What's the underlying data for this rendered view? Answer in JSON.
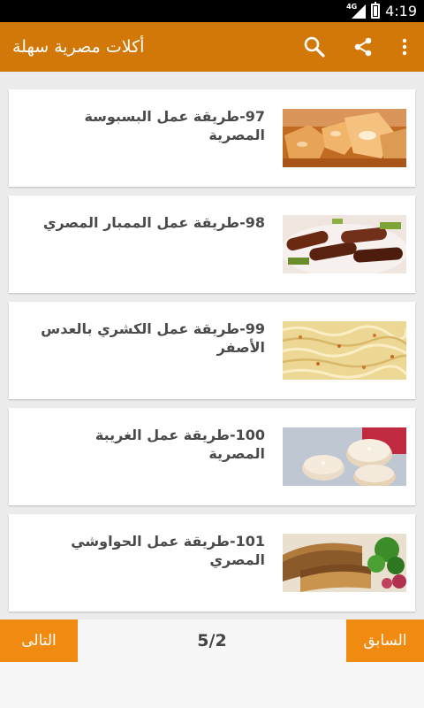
{
  "status_bar": {
    "network": "4G",
    "time": "4:19"
  },
  "app_bar": {
    "title": "أكلات مصرية سهلة",
    "icons": [
      "search-icon",
      "share-icon",
      "overflow-menu-icon"
    ]
  },
  "recipes": [
    {
      "title": "97-طريقة عمل البسبوسة المصرية"
    },
    {
      "title": "98-طريقة عمل الممبار المصري"
    },
    {
      "title": "99-طريقة عمل الكشري بالعدس الأصفر"
    },
    {
      "title": "100-طريقة عمل الغريبة المصرية"
    },
    {
      "title": "101-طريقة عمل الحواوشي المصري"
    }
  ],
  "pagination": {
    "next_label": "التالى",
    "prev_label": "السابق",
    "page": "5/2"
  },
  "colors": {
    "action_bar": "#d17808",
    "nav_button": "#f08a10",
    "list_background": "#ececec"
  }
}
